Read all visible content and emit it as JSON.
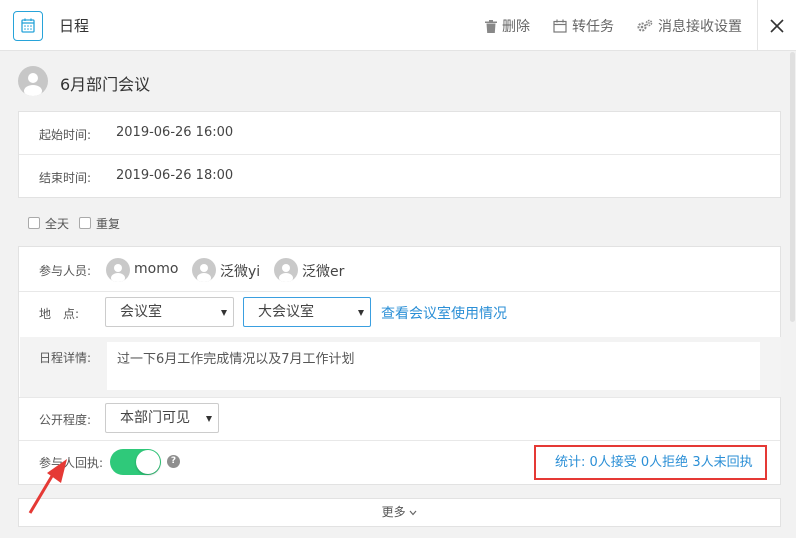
{
  "header": {
    "title": "日程",
    "actions": {
      "delete_label": "删除",
      "convert_label": "转任务",
      "notify_label": "消息接收设置"
    }
  },
  "event": {
    "title": "6月部门会议"
  },
  "times": {
    "start_label": "起始时间:",
    "start_value": "2019-06-26 16:00",
    "end_label": "结束时间:",
    "end_value": "2019-06-26 18:00"
  },
  "options": {
    "all_day_label": "全天",
    "all_day_checked": false,
    "repeat_label": "重复",
    "repeat_checked": false
  },
  "participants": {
    "label": "参与人员:",
    "people": [
      "momo",
      "泛微yi",
      "泛微er"
    ]
  },
  "location": {
    "label": "地　点:",
    "select1_value": "会议室",
    "select2_value": "大会议室",
    "link_label": "查看会议室使用情况"
  },
  "details": {
    "label": "日程详情:",
    "value": "过一下6月工作完成情况以及7月工作计划"
  },
  "visibility": {
    "label": "公开程度:",
    "value": "本部门可见"
  },
  "receipt": {
    "label": "参与人回执:",
    "enabled": true,
    "help_symbol": "?",
    "stats_text": "统计: 0人接受 0人拒绝 3人未回执"
  },
  "more": {
    "label": "更多"
  },
  "colors": {
    "accent": "#2b8fd6",
    "toggle_on": "#2fc97a",
    "highlight": "#e53935"
  }
}
